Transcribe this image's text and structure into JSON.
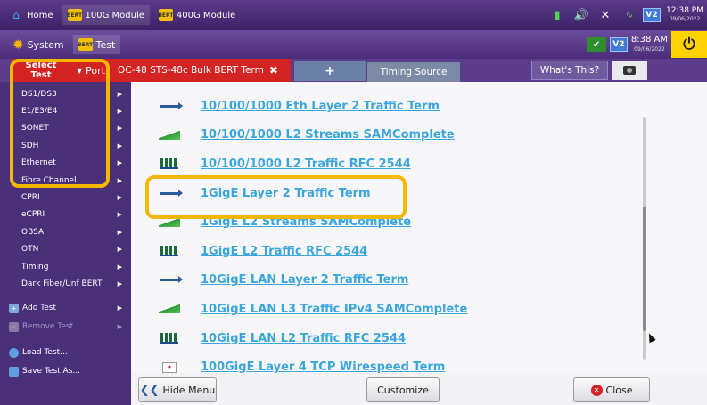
{
  "topbar": {
    "tabs": [
      {
        "label": "Home",
        "icon": "home-icon"
      },
      {
        "label": "100G Module",
        "icon": "bert-module-icon"
      },
      {
        "label": "400G Module",
        "icon": "bert-module-icon"
      }
    ],
    "bert_badge": "BERT",
    "v2_badge": "V2",
    "clock_time": "12:38 PM",
    "clock_date": "09/06/2022"
  },
  "subbar": {
    "system_label": "System",
    "test_label": "Test",
    "v2_badge": "V2",
    "clock_time": "8:38 AM",
    "clock_date": "09/06/2022"
  },
  "tabs": {
    "select_label": "Select",
    "test_label": "Test",
    "port_label": "Port",
    "active_tab": "OC-48 STS-48c Bulk BERT Term",
    "add_tab": "+",
    "timing_tab": "Timing Source",
    "whats_this": "What's This?"
  },
  "menu": {
    "categories": [
      {
        "label": "DS1/DS3"
      },
      {
        "label": "E1/E3/E4"
      },
      {
        "label": "SONET"
      },
      {
        "label": "SDH"
      },
      {
        "label": "Ethernet"
      },
      {
        "label": "Fibre Channel"
      },
      {
        "label": "CPRI"
      },
      {
        "label": "eCPRI"
      },
      {
        "label": "OBSAI"
      },
      {
        "label": "OTN"
      },
      {
        "label": "Timing"
      },
      {
        "label": "Dark Fiber/Unf BERT"
      }
    ],
    "actions": [
      {
        "label": "Add Test",
        "icon": "add-test-icon",
        "enabled": true
      },
      {
        "label": "Remove Test",
        "icon": "remove-test-icon",
        "enabled": false
      }
    ],
    "file_actions": [
      {
        "label": "Load Test...",
        "icon": "load-test-icon"
      },
      {
        "label": "Save Test As...",
        "icon": "save-test-icon"
      }
    ]
  },
  "tests": [
    {
      "label": "10/100/1000 Eth Layer 2 Traffic Term",
      "icon": "arrow-traffic-icon"
    },
    {
      "label": "10/100/1000 L2 Streams SAMComplete",
      "icon": "streams-icon"
    },
    {
      "label": "10/100/1000 L2 Traffic RFC 2544",
      "icon": "rfc2544-icon"
    },
    {
      "label": "1GigE Layer 2 Traffic Term",
      "icon": "arrow-traffic-icon"
    },
    {
      "label": "1GigE L2 Streams SAMComplete",
      "icon": "streams-icon"
    },
    {
      "label": "1GigE L2 Traffic RFC 2544",
      "icon": "rfc2544-icon"
    },
    {
      "label": "10GigE LAN Layer 2 Traffic Term",
      "icon": "arrow-traffic-icon"
    },
    {
      "label": "10GigE LAN L3 Traffic IPv4 SAMComplete",
      "icon": "streams-icon"
    },
    {
      "label": "10GigE LAN L2 Traffic RFC 2544",
      "icon": "rfc2544-icon"
    },
    {
      "label": "100GigE Layer 4 TCP Wirespeed Term",
      "icon": "tcp-icon"
    }
  ],
  "bottom": {
    "hide_menu": "Hide Menu",
    "customize": "Customize",
    "close": "Close"
  },
  "colors": {
    "accent_red": "#d42323",
    "highlight": "#f3b700",
    "link_blue": "#3ba6dc",
    "menu_purple": "#4a2f79"
  }
}
